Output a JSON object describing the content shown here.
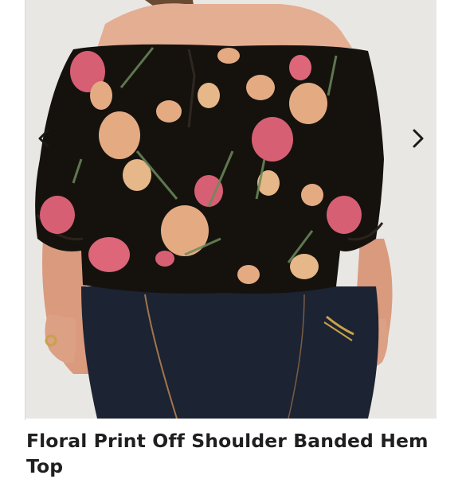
{
  "listing": {
    "title": "Floral Print Off Shoulder Banded Hem Top"
  },
  "carousel": {
    "prev_icon": "chevron-left-icon",
    "next_icon": "chevron-right-icon"
  },
  "colors": {
    "blouse": "#17130f",
    "denim": "#1d2433",
    "skin": "#e0a58b",
    "flower_pink": "#e2647a",
    "flower_peach": "#f0b48a",
    "leaf": "#6b8a5a"
  }
}
